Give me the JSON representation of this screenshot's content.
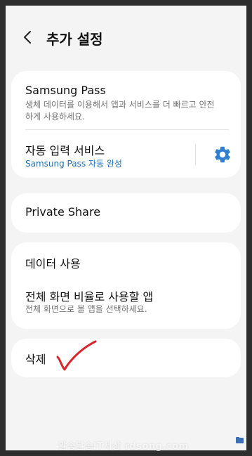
{
  "header": {
    "title": "추가 설정",
    "back_icon": "chevron-left-icon"
  },
  "card1": {
    "samsung_pass": {
      "title": "Samsung Pass",
      "subtitle": "생체 데이터를 이용해서 앱과 서비스를 더 빠르고 안전하게 사용하세요."
    },
    "autofill": {
      "title": "자동 입력 서비스",
      "subtitle": "Samsung Pass 자동 완성",
      "settings_icon": "gear-icon"
    }
  },
  "card2": {
    "private_share": {
      "title": "Private Share"
    }
  },
  "card3": {
    "data_usage": {
      "title": "데이터 사용"
    },
    "fullscreen_apps": {
      "title": "전체 화면 비율로 사용할 앱",
      "subtitle": "전체 화면으로 볼 앱을 선택하세요."
    }
  },
  "card4": {
    "delete": {
      "title": "삭제"
    }
  },
  "watermark": "알송달송IT세상 rdsong.com",
  "colors": {
    "accent": "#1d6fb8",
    "gear": "#2f7fd0",
    "annotation": "#d9262c",
    "background": "#f4f4f4"
  }
}
